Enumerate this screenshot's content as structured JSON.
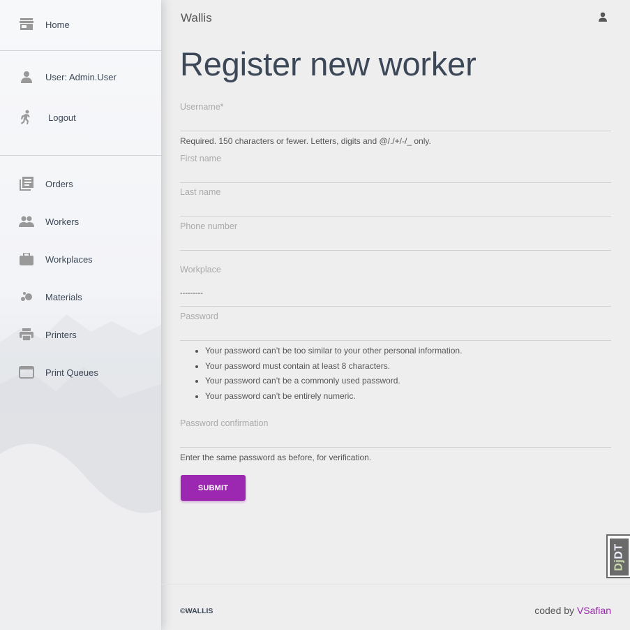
{
  "sidebar": {
    "items": [
      {
        "label": "Home",
        "icon": "store-icon"
      },
      {
        "label": "User: Admin.User",
        "icon": "person-icon"
      },
      {
        "label": "Logout",
        "icon": "run-icon"
      },
      {
        "label": "Orders",
        "icon": "library-books-icon"
      },
      {
        "label": "Workers",
        "icon": "people-icon"
      },
      {
        "label": "Workplaces",
        "icon": "work-icon"
      },
      {
        "label": "Materials",
        "icon": "bubble-chart-icon"
      },
      {
        "label": "Printers",
        "icon": "print-icon"
      },
      {
        "label": "Print Queues",
        "icon": "web-asset-icon"
      }
    ]
  },
  "header": {
    "brand": "Wallis",
    "user_icon": "person-icon"
  },
  "page": {
    "title": "Register new worker"
  },
  "form": {
    "username": {
      "label": "Username*",
      "value": "",
      "help": "Required. 150 characters or fewer. Letters, digits and @/./+/-/_ only."
    },
    "first_name": {
      "label": "First name",
      "value": ""
    },
    "last_name": {
      "label": "Last name",
      "value": ""
    },
    "phone": {
      "label": "Phone number",
      "value": ""
    },
    "workplace": {
      "label": "Workplace",
      "value": "---------"
    },
    "password": {
      "label": "Password",
      "value": "",
      "rules": [
        "Your password can’t be too similar to your other personal information.",
        "Your password must contain at least 8 characters.",
        "Your password can’t be a commonly used password.",
        "Your password can’t be entirely numeric."
      ]
    },
    "password_confirm": {
      "label": "Password confirmation",
      "value": "",
      "help": "Enter the same password as before, for verification."
    },
    "submit_label": "SUBMIT"
  },
  "footer": {
    "copyright": "©WALLIS",
    "coded_by": "coded by",
    "author": "VSafian"
  },
  "toolbar": {
    "djdt_prefix": "Dj",
    "djdt_suffix": "DT"
  },
  "colors": {
    "accent": "#9c27b0",
    "text": "#3c4858",
    "background": "#eeeeee"
  }
}
